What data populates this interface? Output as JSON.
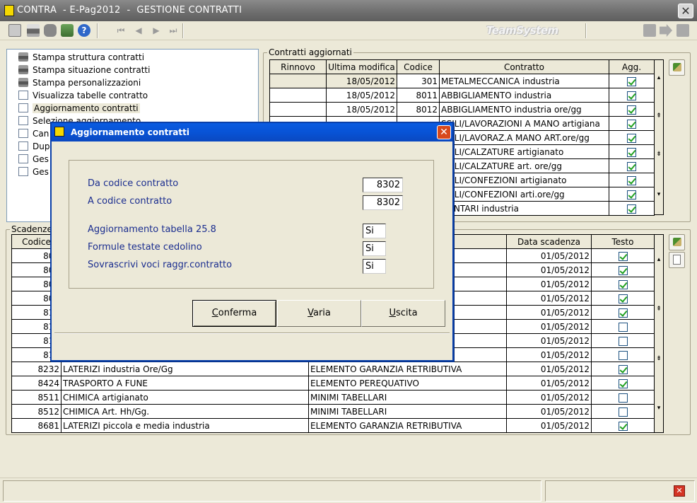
{
  "window": {
    "title": "CONTRA  - E-Pag2012  -  GESTIONE CONTRATTI",
    "close_glyph": "✕"
  },
  "toolbar": {
    "brand": "TeamSystem",
    "nav": {
      "first": "⏮",
      "prev": "◀",
      "next": "▶",
      "last": "⏭"
    }
  },
  "tree": {
    "items": [
      {
        "label": "Stampa struttura contratti",
        "icon": "printer-icon"
      },
      {
        "label": "Stampa situazione contratti",
        "icon": "printer-icon"
      },
      {
        "label": "Stampa personalizzazioni",
        "icon": "printer-icon"
      },
      {
        "label": "Visualizza tabelle contratto",
        "icon": "doc-icon"
      },
      {
        "label": "Aggiornamento contratti",
        "icon": "doc-icon"
      },
      {
        "label": "Selezione aggiornamento",
        "icon": "doc-icon"
      },
      {
        "label": "Can",
        "icon": "doc-icon"
      },
      {
        "label": "Dup",
        "icon": "doc-icon"
      },
      {
        "label": "Ges",
        "icon": "doc-icon"
      },
      {
        "label": "Ges",
        "icon": "doc-icon"
      }
    ]
  },
  "updated": {
    "group_label": "Contratti aggiornati",
    "columns": [
      "Rinnovo",
      "Ultima modifica",
      "Codice",
      "Contratto",
      "Agg."
    ],
    "rows": [
      {
        "rinnovo": "",
        "modifica": "18/05/2012",
        "codice": "301",
        "contratto": "METALMECCANICA industria",
        "agg": true
      },
      {
        "rinnovo": "",
        "modifica": "18/05/2012",
        "codice": "8011",
        "contratto": "ABBIGLIAMENTO industria",
        "agg": true
      },
      {
        "rinnovo": "",
        "modifica": "18/05/2012",
        "codice": "8012",
        "contratto": "ABBIGLIAMENTO industria ore/gg",
        "agg": true
      },
      {
        "rinnovo": "",
        "modifica": "",
        "codice": "",
        "contratto": "SSILI/LAVORAZIONI A MANO artigiana",
        "agg": true
      },
      {
        "rinnovo": "",
        "modifica": "",
        "codice": "",
        "contratto": "SSILI/LAVORAZ.A MANO ART.ore/gg",
        "agg": true
      },
      {
        "rinnovo": "",
        "modifica": "",
        "codice": "",
        "contratto": "SSILI/CALZATURE artigianato",
        "agg": true
      },
      {
        "rinnovo": "",
        "modifica": "",
        "codice": "",
        "contratto": "SSILI/CALZATURE art. ore/gg",
        "agg": true
      },
      {
        "rinnovo": "",
        "modifica": "",
        "codice": "",
        "contratto": "SSILI/CONFEZIONI artigianato",
        "agg": true
      },
      {
        "rinnovo": "",
        "modifica": "",
        "codice": "",
        "contratto": "SSILI/CONFEZIONI arti.ore/gg",
        "agg": true
      },
      {
        "rinnovo": "",
        "modifica": "",
        "codice": "",
        "contratto": "MENTARI industria",
        "agg": true
      }
    ]
  },
  "deadlines": {
    "group_label": "Scadenze",
    "columns": [
      "Codice",
      "",
      "",
      "Data scadenza",
      "Testo"
    ],
    "rows": [
      {
        "codice": "805",
        "contratto": "",
        "voce": "",
        "data": "01/05/2012",
        "testo": true
      },
      {
        "codice": "805",
        "contratto": "",
        "voce": "",
        "data": "01/05/2012",
        "testo": true
      },
      {
        "codice": "807",
        "contratto": "",
        "voce": "",
        "data": "01/05/2012",
        "testo": true
      },
      {
        "codice": "807",
        "contratto": "",
        "voce": "",
        "data": "01/05/2012",
        "testo": true
      },
      {
        "codice": "815",
        "contratto": "",
        "voce": "",
        "data": "01/05/2012",
        "testo": true
      },
      {
        "codice": "818",
        "contratto": "",
        "voce": "",
        "data": "01/05/2012",
        "testo": false
      },
      {
        "codice": "818",
        "contratto": "",
        "voce": "",
        "data": "01/05/2012",
        "testo": false
      },
      {
        "codice": "818",
        "contratto": "",
        "voce": "",
        "data": "01/05/2012",
        "testo": false
      },
      {
        "codice": "8232",
        "contratto": "LATERIZI industria Ore/Gg",
        "voce": "ELEMENTO GARANZIA RETRIBUTIVA",
        "data": "01/05/2012",
        "testo": true
      },
      {
        "codice": "8424",
        "contratto": "TRASPORTO A FUNE",
        "voce": "ELEMENTO PEREQUATIVO",
        "data": "01/05/2012",
        "testo": true
      },
      {
        "codice": "8511",
        "contratto": "CHIMICA artigianato",
        "voce": "MINIMI TABELLARI",
        "data": "01/05/2012",
        "testo": false
      },
      {
        "codice": "8512",
        "contratto": "CHIMICA Art. Hh/Gg.",
        "voce": "MINIMI TABELLARI",
        "data": "01/05/2012",
        "testo": false
      },
      {
        "codice": "8681",
        "contratto": "LATERIZI piccola e media industria",
        "voce": "ELEMENTO GARANZIA RETRIBUTIVA",
        "data": "01/05/2012",
        "testo": true
      }
    ]
  },
  "dialog": {
    "title": "Aggiornamento contratti",
    "close_glyph": "✕",
    "from_label": "Da codice contratto",
    "from_value": "8302",
    "to_label": "A  codice contratto",
    "to_value": "8302",
    "opt1_label": "Aggiornamento tabella 25.8",
    "opt1_value": "Si",
    "opt2_label": "Formule testate cedolino",
    "opt2_value": "Si",
    "opt3_label": "Sovrascrivi voci raggr.contratto",
    "opt3_value": "Si",
    "buttons": {
      "confirm": {
        "accel": "C",
        "rest": "onferma"
      },
      "vary": {
        "accel": "V",
        "rest": "aria"
      },
      "exit": {
        "accel": "U",
        "rest": "scita"
      }
    }
  },
  "statusbar": {
    "close_glyph": "✕"
  }
}
